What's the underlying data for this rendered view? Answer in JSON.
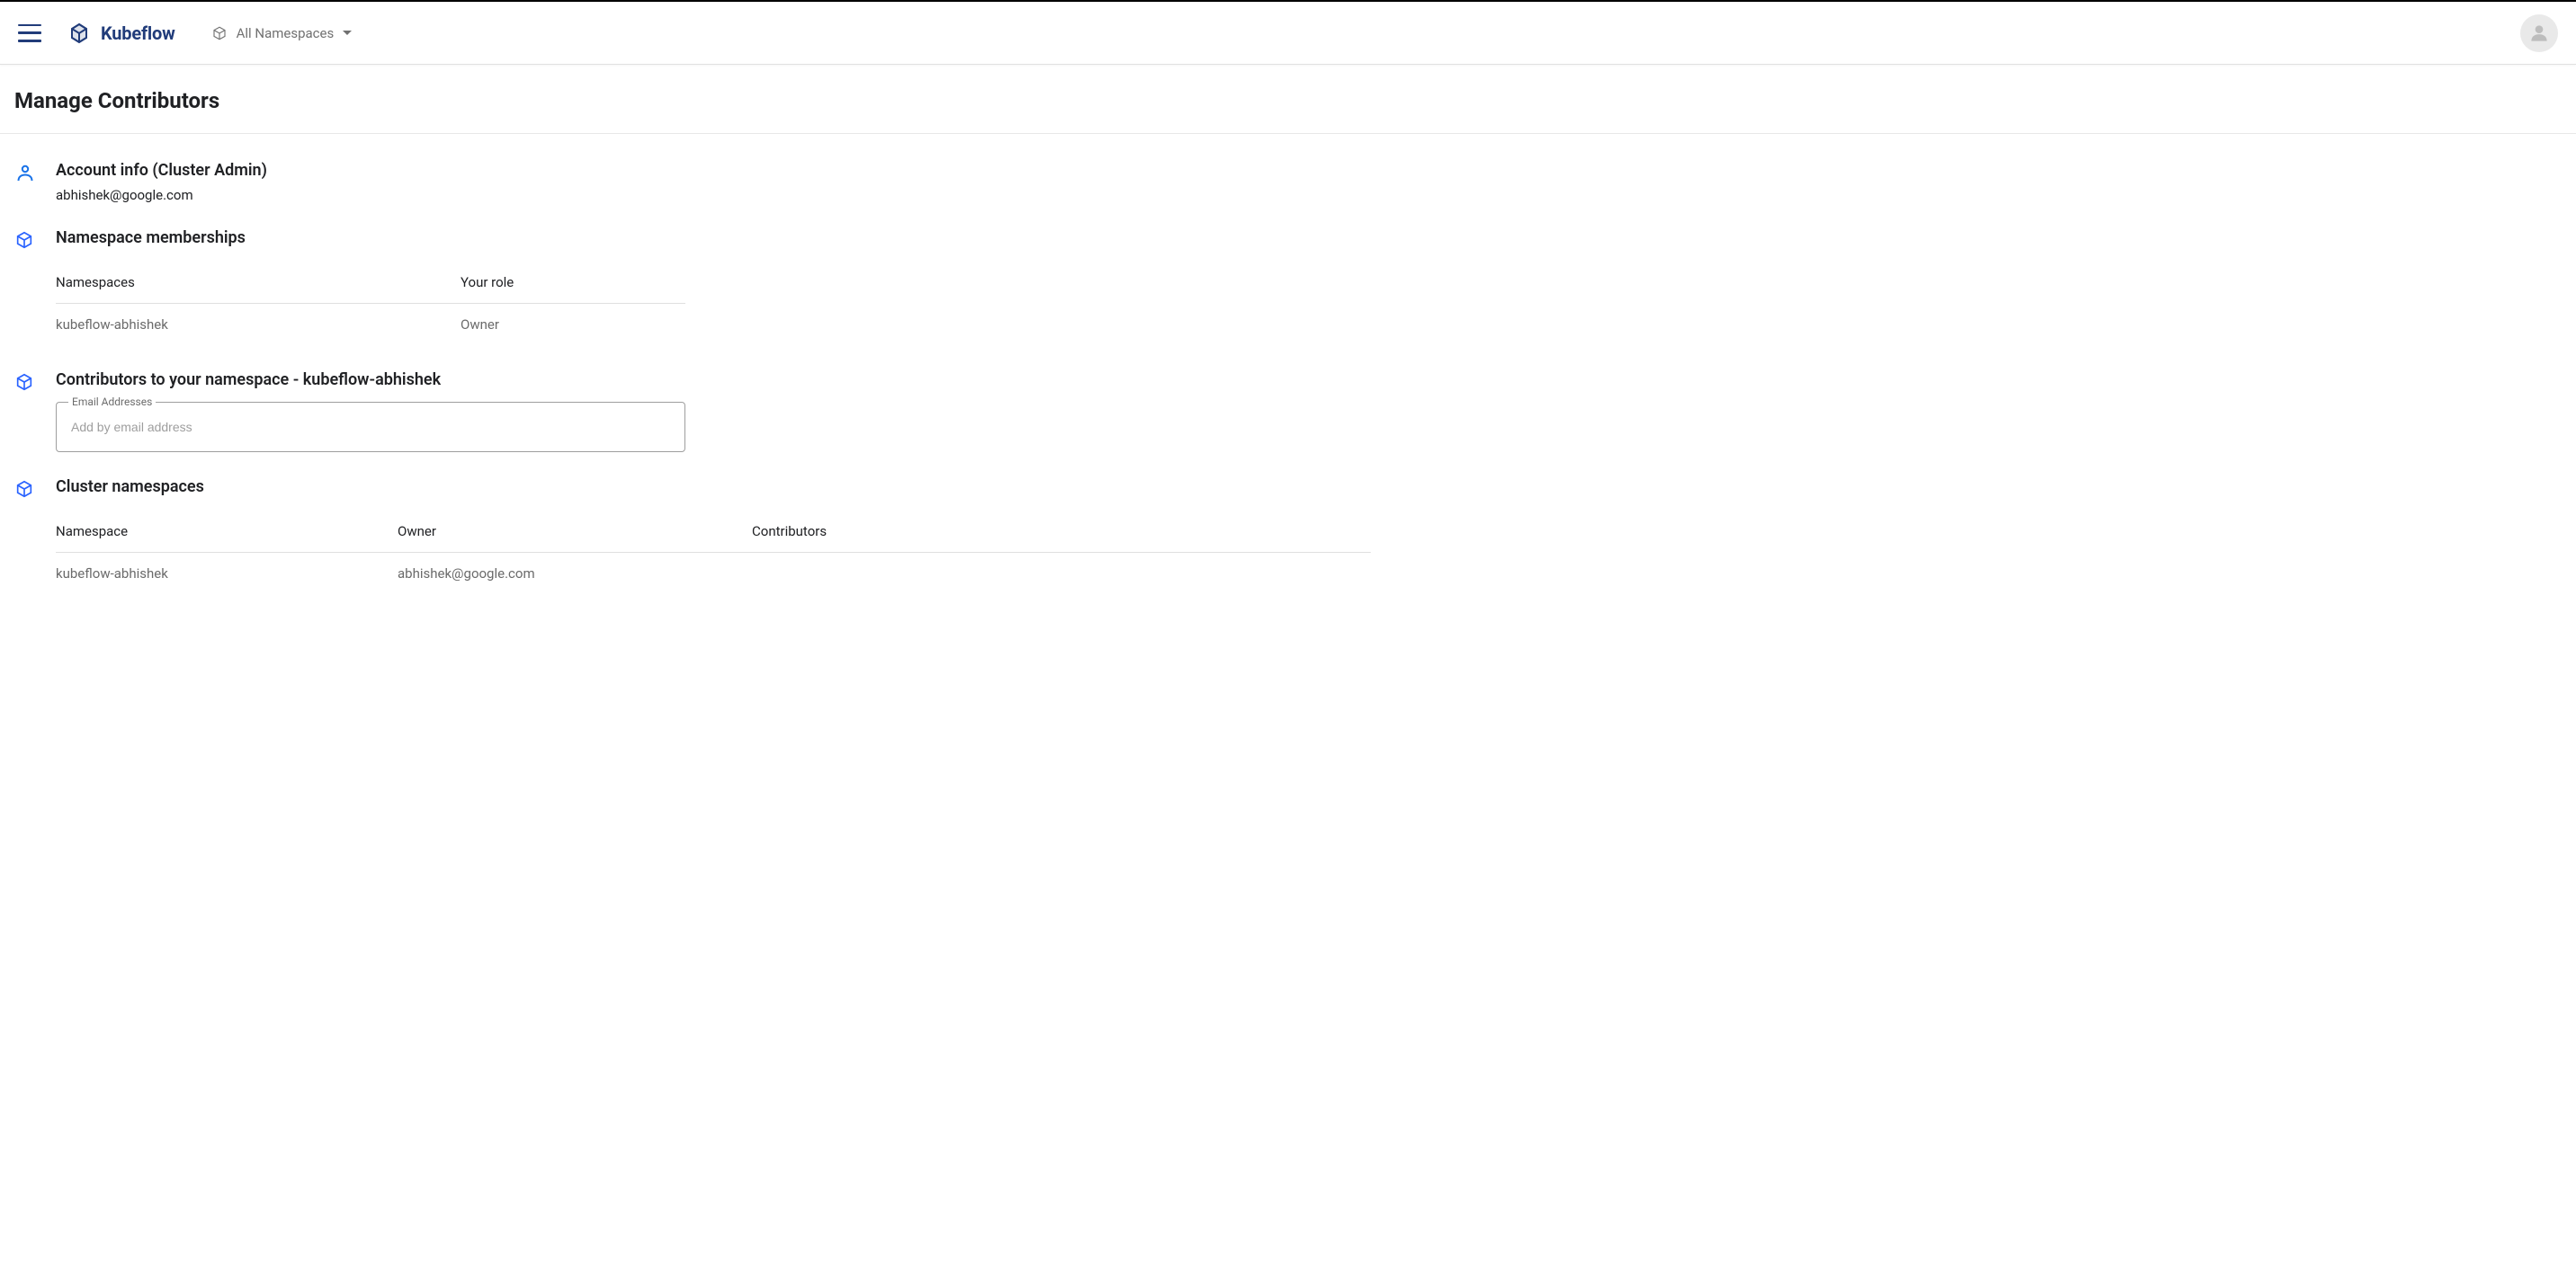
{
  "header": {
    "brand": "Kubeflow",
    "namespace_selector": "All Namespaces"
  },
  "page": {
    "title": "Manage Contributors"
  },
  "account": {
    "heading": "Account info  (Cluster Admin)",
    "email": "abhishek@google.com"
  },
  "memberships": {
    "heading": "Namespace memberships",
    "columns": {
      "ns": "Namespaces",
      "role": "Your role"
    },
    "rows": [
      {
        "ns": "kubeflow-abhishek",
        "role": "Owner"
      }
    ]
  },
  "contributors": {
    "heading": "Contributors to your namespace - kubeflow-abhishek",
    "field_label": "Email Addresses",
    "placeholder": "Add by email address"
  },
  "cluster": {
    "heading": "Cluster namespaces",
    "columns": {
      "ns": "Namespace",
      "owner": "Owner",
      "contributors": "Contributors"
    },
    "rows": [
      {
        "ns": "kubeflow-abhishek",
        "owner": "abhishek@google.com",
        "contributors": ""
      }
    ]
  }
}
